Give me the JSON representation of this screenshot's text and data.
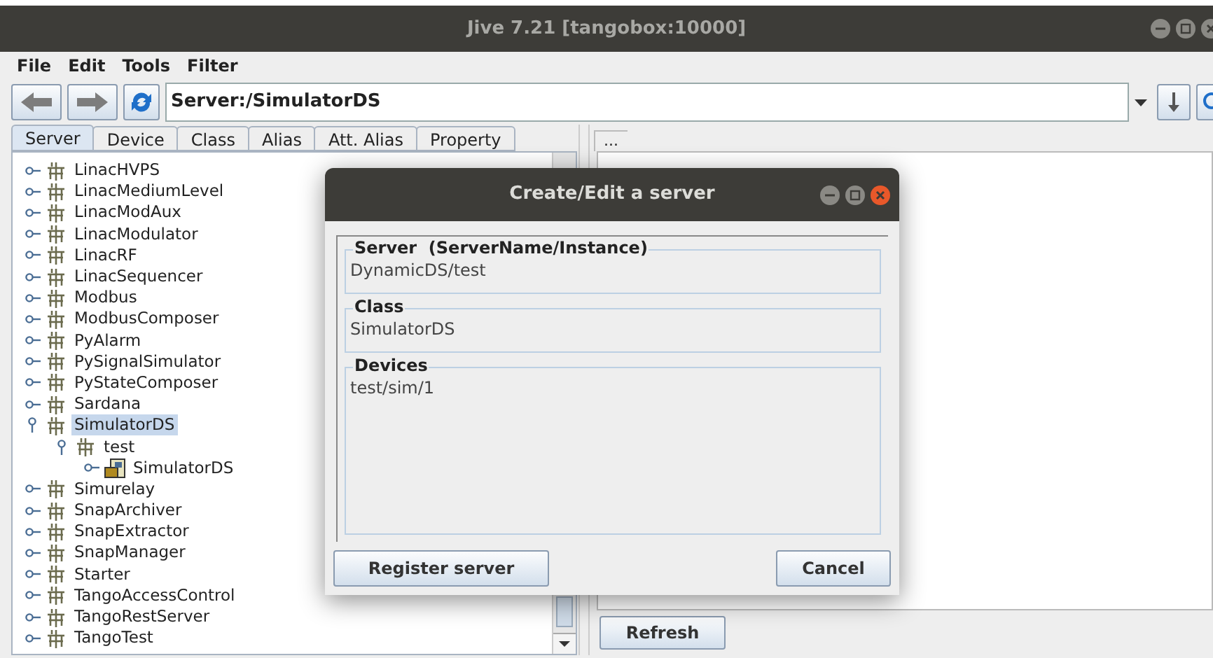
{
  "window": {
    "title": "Jive 7.21 [tangobox:10000]"
  },
  "menu": [
    "File",
    "Edit",
    "Tools",
    "Filter"
  ],
  "toolbar": {
    "address": "Server:/SimulatorDS"
  },
  "tabs": [
    {
      "label": "Server",
      "selected": true
    },
    {
      "label": "Device",
      "selected": false
    },
    {
      "label": "Class",
      "selected": false
    },
    {
      "label": "Alias",
      "selected": false
    },
    {
      "label": "Att. Alias",
      "selected": false
    },
    {
      "label": "Property",
      "selected": false
    }
  ],
  "tree": [
    {
      "label": "LinacHVPS",
      "kind": "server",
      "expanded": false,
      "selected": false
    },
    {
      "label": "LinacMediumLevel",
      "kind": "server",
      "expanded": false,
      "selected": false
    },
    {
      "label": "LinacModAux",
      "kind": "server",
      "expanded": false,
      "selected": false
    },
    {
      "label": "LinacModulator",
      "kind": "server",
      "expanded": false,
      "selected": false
    },
    {
      "label": "LinacRF",
      "kind": "server",
      "expanded": false,
      "selected": false
    },
    {
      "label": "LinacSequencer",
      "kind": "server",
      "expanded": false,
      "selected": false
    },
    {
      "label": "Modbus",
      "kind": "server",
      "expanded": false,
      "selected": false
    },
    {
      "label": "ModbusComposer",
      "kind": "server",
      "expanded": false,
      "selected": false
    },
    {
      "label": "PyAlarm",
      "kind": "server",
      "expanded": false,
      "selected": false
    },
    {
      "label": "PySignalSimulator",
      "kind": "server",
      "expanded": false,
      "selected": false
    },
    {
      "label": "PyStateComposer",
      "kind": "server",
      "expanded": false,
      "selected": false
    },
    {
      "label": "Sardana",
      "kind": "server",
      "expanded": false,
      "selected": false
    },
    {
      "label": "SimulatorDS",
      "kind": "server",
      "expanded": true,
      "selected": true,
      "children": [
        {
          "label": "test",
          "kind": "server",
          "expanded": true,
          "selected": false,
          "children": [
            {
              "label": "SimulatorDS",
              "kind": "class",
              "expanded": false,
              "selected": false
            }
          ]
        }
      ]
    },
    {
      "label": "Simurelay",
      "kind": "server",
      "expanded": false,
      "selected": false
    },
    {
      "label": "SnapArchiver",
      "kind": "server",
      "expanded": false,
      "selected": false
    },
    {
      "label": "SnapExtractor",
      "kind": "server",
      "expanded": false,
      "selected": false
    },
    {
      "label": "SnapManager",
      "kind": "server",
      "expanded": false,
      "selected": false
    },
    {
      "label": "Starter",
      "kind": "server",
      "expanded": false,
      "selected": false
    },
    {
      "label": "TangoAccessControl",
      "kind": "server",
      "expanded": false,
      "selected": false
    },
    {
      "label": "TangoRestServer",
      "kind": "server",
      "expanded": false,
      "selected": false
    },
    {
      "label": "TangoTest",
      "kind": "server",
      "expanded": false,
      "selected": false
    }
  ],
  "right_panel": {
    "header": "...",
    "buttons": [
      "Refresh"
    ]
  },
  "dialog": {
    "title": "Create/Edit a server",
    "fields": [
      {
        "label": "Server  (ServerName/Instance)",
        "value": "DynamicDS/test",
        "kind": "line"
      },
      {
        "label": "Class",
        "value": "SimulatorDS",
        "kind": "line"
      },
      {
        "label": "Devices",
        "value": "test/sim/1",
        "kind": "list"
      }
    ],
    "buttons": [
      "Register server",
      "Cancel"
    ]
  }
}
